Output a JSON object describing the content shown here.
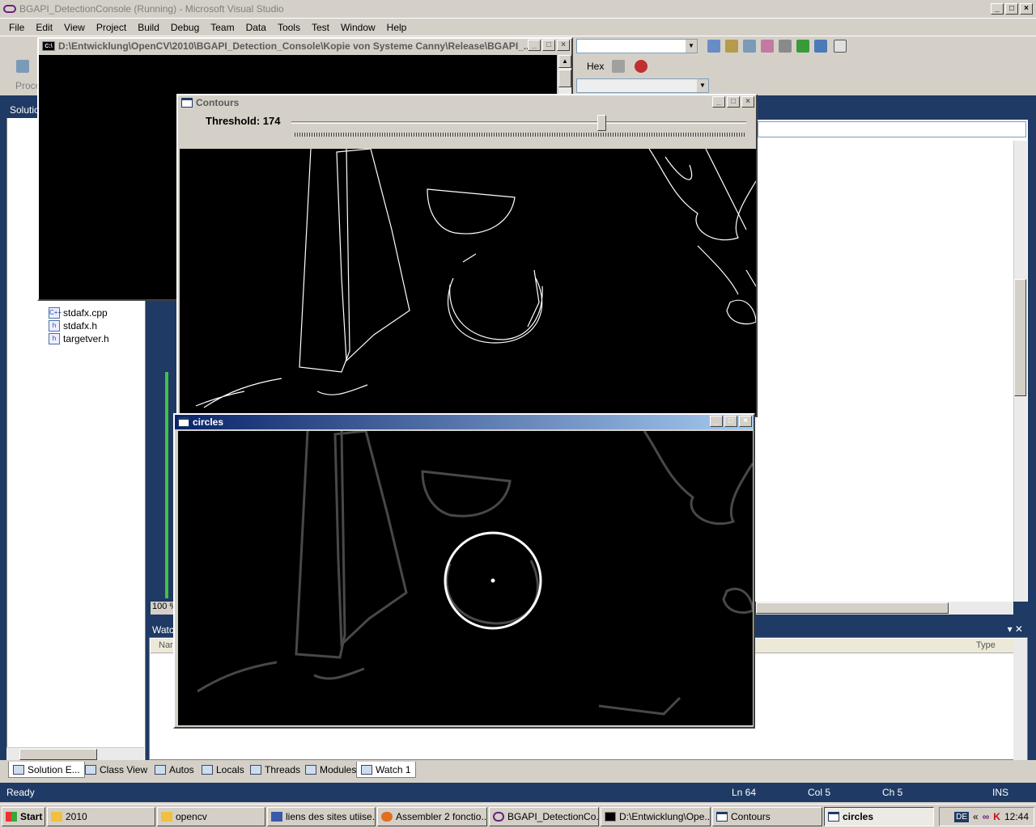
{
  "vs": {
    "title": "BGAPI_DetectionConsole (Running) - Microsoft Visual Studio",
    "menu": [
      "File",
      "Edit",
      "View",
      "Project",
      "Build",
      "Debug",
      "Team",
      "Data",
      "Tools",
      "Test",
      "Window",
      "Help"
    ],
    "toolbar": {
      "hex_label": "Hex",
      "process_label": "Proce"
    }
  },
  "solution_explorer": {
    "header": "Solutio",
    "files": [
      "stdafx.cpp",
      "stdafx.h",
      "targetver.h"
    ]
  },
  "editor": {
    "zoom": "100 %"
  },
  "watch": {
    "header": "Watch",
    "col_name": "Nar",
    "col_type": "Type"
  },
  "tabs": {
    "left": [
      "Solution E...",
      "Class View"
    ],
    "bottom": [
      "Autos",
      "Locals",
      "Threads",
      "Modules",
      "Watch 1"
    ]
  },
  "status": {
    "ready": "Ready",
    "ln": "Ln 64",
    "col": "Col 5",
    "ch": "Ch 5",
    "ins": "INS"
  },
  "console": {
    "title": "D:\\Entwicklung\\OpenCV\\2010\\BGAPI_Detection_Console\\Kopie von Systeme Canny\\Release\\BGAPI_..."
  },
  "contours": {
    "title": "Contours",
    "threshold_label": "Threshold: 174",
    "threshold_value": 174,
    "threshold_max": 255
  },
  "circles": {
    "title": "circles"
  },
  "taskbar": {
    "start": "Start",
    "items": [
      "2010",
      "opencv",
      "liens des sites utiise...",
      "Assembler 2 fonctio...",
      "BGAPI_DetectionCo...",
      "D:\\Entwicklung\\Ope...",
      "Contours",
      "circles"
    ],
    "tray_lang": "DE",
    "clock": "12:44"
  },
  "colors": {
    "workspace": "#1f3a64",
    "active_title": "#0a246a",
    "circle": "#ffffff"
  }
}
